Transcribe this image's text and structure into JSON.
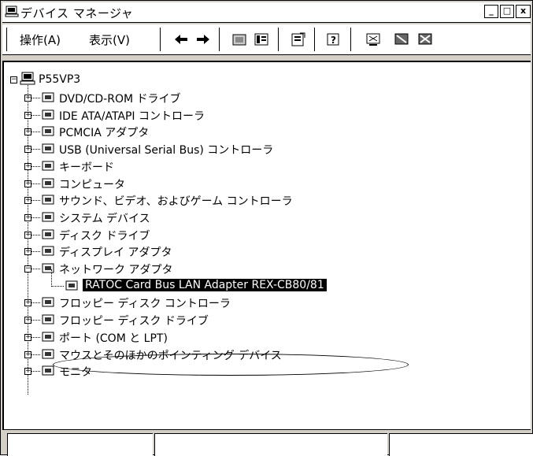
{
  "window": {
    "title": "デバイス マネージャ"
  },
  "titlebar_buttons": {
    "minimize": "_",
    "maximize": "□",
    "close": "x"
  },
  "menu": {
    "action": "操作(A)",
    "view": "表示(V)"
  },
  "tree": {
    "root": "P55VP3",
    "items": [
      {
        "label": "DVD/CD-ROM ドライブ",
        "icon": "cdrom-icon",
        "expander": "+"
      },
      {
        "label": "IDE ATA/ATAPI コントローラ",
        "icon": "ide-controller-icon",
        "expander": "+"
      },
      {
        "label": "PCMCIA アダプタ",
        "icon": "pcmcia-icon",
        "expander": "+"
      },
      {
        "label": "USB (Universal Serial Bus) コントローラ",
        "icon": "usb-icon",
        "expander": "+"
      },
      {
        "label": "キーボード",
        "icon": "keyboard-icon",
        "expander": "+"
      },
      {
        "label": "コンピュータ",
        "icon": "computer-icon",
        "expander": "+"
      },
      {
        "label": "サウンド、ビデオ、およびゲーム コントローラ",
        "icon": "sound-icon",
        "expander": "+"
      },
      {
        "label": "システム デバイス",
        "icon": "system-device-icon",
        "expander": "+"
      },
      {
        "label": "ディスク ドライブ",
        "icon": "disk-drive-icon",
        "expander": "+"
      },
      {
        "label": "ディスプレイ アダプタ",
        "icon": "display-icon",
        "expander": "+"
      },
      {
        "label": "ネットワーク アダプタ",
        "icon": "network-icon",
        "expander": "-"
      },
      {
        "label": "RATOC Card Bus LAN Adapter REX-CB80/81",
        "icon": "network-card-icon",
        "selected": true
      },
      {
        "label": "フロッピー ディスク コントローラ",
        "icon": "floppy-controller-icon",
        "expander": "+"
      },
      {
        "label": "フロッピー ディスク ドライブ",
        "icon": "floppy-drive-icon",
        "expander": "+"
      },
      {
        "label": "ポート (COM と LPT)",
        "icon": "port-icon",
        "expander": "+"
      },
      {
        "label": "マウスとそのほかのポインティング デバイス",
        "icon": "mouse-icon",
        "expander": "+"
      },
      {
        "label": "モニタ",
        "icon": "monitor-icon",
        "expander": "+"
      }
    ]
  }
}
